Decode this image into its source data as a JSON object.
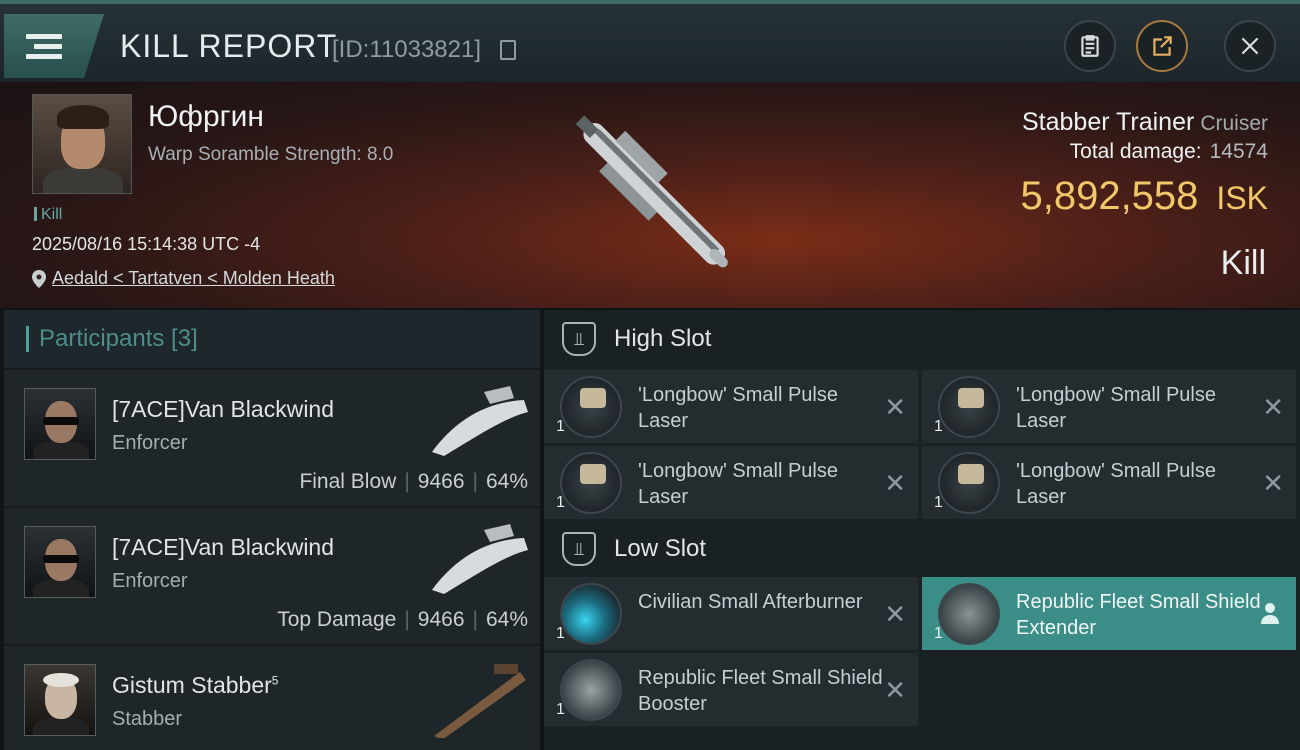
{
  "header": {
    "title": "KILL REPORT",
    "report_id": "[ID:11033821]",
    "icons": [
      "menu-icon",
      "copy-icon",
      "clipboard-icon",
      "share-icon",
      "close-icon"
    ]
  },
  "victim": {
    "name": "Юфргин",
    "scramble": "Warp Soramble Strength: 8.0",
    "tag": "Kill",
    "datetime": "2025/08/16 15:14:38 UTC -4",
    "location": "Aedald < Tartatven < Molden Heath"
  },
  "ship": {
    "name": "Stabber Trainer",
    "class": "Cruiser",
    "damage_label": "Total damage:",
    "damage_value": "14574",
    "isk_value": "5,892,558",
    "isk_currency": "ISK",
    "result": "Kill"
  },
  "participants": {
    "header": "Participants [3]",
    "items": [
      {
        "name": "[7ACE]Van Blackwind",
        "sup": "",
        "ship": "Enforcer",
        "label": "Final Blow",
        "damage": "9466",
        "percent": "64%"
      },
      {
        "name": "[7ACE]Van Blackwind",
        "sup": "",
        "ship": "Enforcer",
        "label": "Top Damage",
        "damage": "9466",
        "percent": "64%"
      },
      {
        "name": "Gistum Stabber",
        "sup": "5",
        "ship": "Stabber",
        "label": "",
        "damage": "",
        "percent": ""
      }
    ]
  },
  "slots": {
    "high_title": "High Slot",
    "low_title": "Low Slot",
    "high": [
      {
        "name": "'Longbow' Small Pulse Laser",
        "qty": "1"
      },
      {
        "name": "'Longbow' Small Pulse Laser",
        "qty": "1"
      },
      {
        "name": "'Longbow' Small Pulse Laser",
        "qty": "1"
      },
      {
        "name": "'Longbow' Small Pulse Laser",
        "qty": "1"
      }
    ],
    "low": [
      {
        "name": "Civilian Small Afterburner",
        "qty": "1"
      },
      {
        "name": "Republic Fleet Small Shield Extender",
        "qty": "1"
      },
      {
        "name": "Republic Fleet Small Shield Booster",
        "qty": "1"
      }
    ]
  },
  "colors": {
    "accent": "#3b8d87",
    "isk": "#f1c76a",
    "teal_text": "#4e8d89"
  }
}
